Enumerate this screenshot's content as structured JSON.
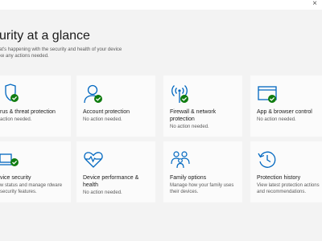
{
  "window": {
    "close_glyph": "×"
  },
  "page": {
    "title": "urity at a glance",
    "subtitle_line1": "at's happening with the security and health of your device",
    "subtitle_line2": "ke any actions needed."
  },
  "tiles": [
    {
      "title": "rus & threat protection",
      "status": "action needed.",
      "icon": "shield-icon"
    },
    {
      "title": "Account protection",
      "status": "No action needed.",
      "icon": "person-icon"
    },
    {
      "title": "Firewall & network protection",
      "status": "No action needed.",
      "icon": "wifi-antenna-icon"
    },
    {
      "title": "App & browser control",
      "status": "No action needed.",
      "icon": "browser-window-icon"
    },
    {
      "title": "vice security",
      "status": "w status and manage rdware security features.",
      "icon": "laptop-icon"
    },
    {
      "title": "Device performance & health",
      "status": "No action needed.",
      "icon": "heart-pulse-icon"
    },
    {
      "title": "Family options",
      "status": "Manage how your family uses their devices.",
      "icon": "family-icon"
    },
    {
      "title": "Protection history",
      "status": "View latest protection actions and recommendations.",
      "icon": "history-clock-icon"
    }
  ],
  "colors": {
    "accent": "#0067c0",
    "check_green": "#107c10",
    "tile_bg": "#fbfbfb",
    "page_bg": "#f3f3f3"
  }
}
